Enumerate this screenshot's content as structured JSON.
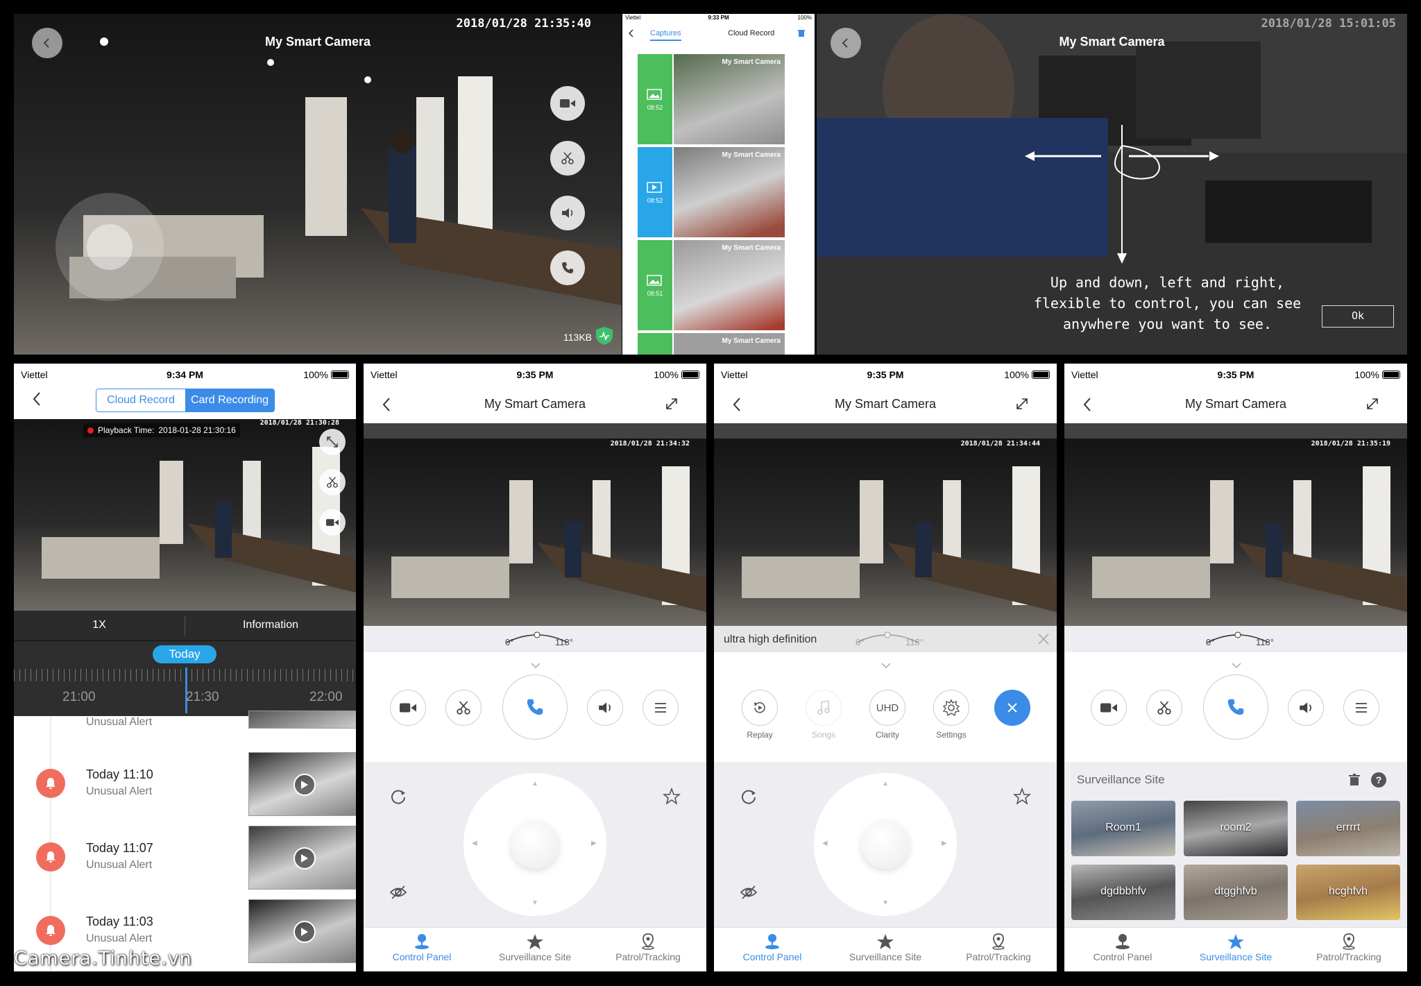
{
  "p1": {
    "title": "My Smart Camera",
    "timestamp": "2018/01/28 21:35:40",
    "bitrate": "113KB"
  },
  "p2": {
    "status": {
      "carrier": "Viettel",
      "time": "9:33 PM",
      "battery": "100%"
    },
    "tabs": [
      "Captures",
      "Cloud Record"
    ],
    "items": [
      {
        "time": "08:52",
        "overlay": "My Smart Camera"
      },
      {
        "time": "08:52",
        "overlay": "My Smart Camera"
      },
      {
        "time": "08:51",
        "overlay": "My Smart Camera"
      },
      {
        "time": "",
        "overlay": "My Smart Camera"
      }
    ]
  },
  "p3": {
    "title": "My Smart Camera",
    "timestamp": "2018/01/28 15:01:05",
    "hint_line1": "Up and down, left and right,",
    "hint_line2": "flexible to control, you can see",
    "hint_line3": "anywhere you want to see.",
    "ok": "Ok"
  },
  "p4": {
    "status": {
      "carrier": "Viettel",
      "time": "9:34 PM",
      "battery": "100%"
    },
    "seg": [
      "Cloud Record",
      "Card Recording"
    ],
    "playback_label": "Playback Time:",
    "playback_time": "2018-01-28 21:30:16",
    "timestamp": "2018/01/28 21:30:28",
    "speed": "1X",
    "info": "Information",
    "today": "Today",
    "ticks": [
      "21:00",
      "21:30",
      "22:00"
    ],
    "alerts": [
      {
        "time": "",
        "type": "Unusual Alert"
      },
      {
        "time": "Today 11:10",
        "type": "Unusual Alert"
      },
      {
        "time": "Today 11:07",
        "type": "Unusual Alert"
      },
      {
        "time": "Today 11:03",
        "type": "Unusual Alert"
      }
    ],
    "watermark": "Camera.Tinhte.vn"
  },
  "p5": {
    "status": {
      "carrier": "Viettel",
      "time": "9:35 PM",
      "battery": "100%"
    },
    "title": "My Smart Camera",
    "timestamp": "2018/01/28 21:34:32",
    "angle_min": "0°",
    "angle_max": "118°",
    "tabs": [
      "Control Panel",
      "Surveillance Site",
      "Patrol/Tracking"
    ]
  },
  "p6": {
    "status": {
      "carrier": "Viettel",
      "time": "9:35 PM",
      "battery": "100%"
    },
    "title": "My Smart Camera",
    "timestamp": "2018/01/28 21:34:44",
    "quality_label": "ultra high definition",
    "angle_min": "0°",
    "angle_max": "118°",
    "menu": [
      "Replay",
      "Songs",
      "Clarity",
      "Settings"
    ],
    "uhd": "UHD",
    "tabs": [
      "Control Panel",
      "Surveillance Site",
      "Patrol/Tracking"
    ]
  },
  "p7": {
    "status": {
      "carrier": "Viettel",
      "time": "9:35 PM",
      "battery": "100%"
    },
    "title": "My Smart Camera",
    "timestamp": "2018/01/28 21:35:19",
    "angle_min": "0°",
    "angle_max": "118°",
    "site_title": "Surveillance Site",
    "sites": [
      "Room1",
      "room2",
      "errrrt",
      "dgdbbhfv",
      "dtgghfvb",
      "hcghfvh"
    ],
    "tabs": [
      "Control Panel",
      "Surveillance Site",
      "Patrol/Tracking"
    ]
  },
  "colors": {
    "accent": "#3b8be8",
    "alert": "#f06d5e",
    "green": "#4cbe5c"
  }
}
